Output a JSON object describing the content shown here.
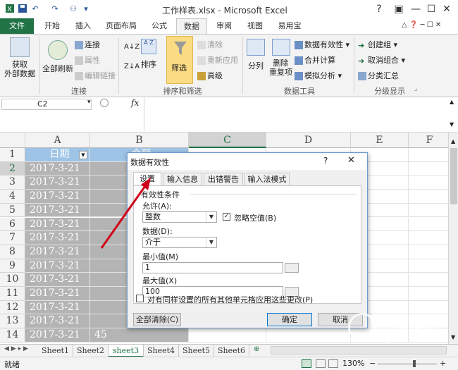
{
  "window": {
    "title": "工作样表.xlsx - Microsoft Excel",
    "help_icon": "?",
    "controls": [
      "restore-ribbon-icon",
      "minimize-icon",
      "maximize-icon",
      "close-icon"
    ]
  },
  "ribbon_tabs": [
    "文件",
    "开始",
    "插入",
    "页面布局",
    "公式",
    "数据",
    "审阅",
    "视图",
    "易用宝"
  ],
  "active_tab": "数据",
  "ribbon": {
    "get_external": "获取\n外部数据",
    "refresh_all": "全部刷新",
    "connections": "连接",
    "properties": "属性",
    "edit_links": "编辑链接",
    "connections_group": "连接",
    "sort_asc": "A↓Z",
    "sort": "排序",
    "filter": "筛选",
    "clear": "清除",
    "reapply": "重新应用",
    "advanced": "高级",
    "sort_filter_group": "排序和筛选",
    "text_to_columns": "分列",
    "remove_duplicates": "删除\n重复项",
    "data_validation": "数据有效性",
    "consolidate": "合并计算",
    "what_if": "模拟分析",
    "data_tools_group": "数据工具",
    "group": "创建组",
    "ungroup": "取消组合",
    "subtotal": "分类汇总",
    "outline_group": "分级显示"
  },
  "formula_bar": {
    "name_box": "C2",
    "fx": "fx"
  },
  "columns": [
    "A",
    "B",
    "C",
    "D",
    "E",
    "F"
  ],
  "rows": [
    {
      "n": "1",
      "a": "日期",
      "b": "金额"
    },
    {
      "n": "2",
      "a": "2017-3-21",
      "b": ""
    },
    {
      "n": "3",
      "a": "2017-3-21",
      "b": ""
    },
    {
      "n": "4",
      "a": "2017-3-21",
      "b": ""
    },
    {
      "n": "5",
      "a": "2017-3-21",
      "b": ""
    },
    {
      "n": "6",
      "a": "2017-3-21",
      "b": ""
    },
    {
      "n": "7",
      "a": "2017-3-21",
      "b": ""
    },
    {
      "n": "8",
      "a": "2017-3-21",
      "b": ""
    },
    {
      "n": "9",
      "a": "2017-3-21",
      "b": ""
    },
    {
      "n": "10",
      "a": "2017-3-21",
      "b": ""
    },
    {
      "n": "11",
      "a": "2017-3-21",
      "b": ""
    },
    {
      "n": "12",
      "a": "2017-3-21",
      "b": ""
    },
    {
      "n": "13",
      "a": "2017-3-21",
      "b": ""
    },
    {
      "n": "14",
      "a": "2017-3-21",
      "b": "45"
    }
  ],
  "sheets": [
    "Sheet1",
    "Sheet2",
    "sheet3",
    "Sheet4",
    "Sheet5",
    "Sheet6"
  ],
  "active_sheet": "sheet3",
  "status": {
    "ready": "就绪",
    "zoom": "130%"
  },
  "dialog": {
    "title": "数据有效性",
    "help": "?",
    "tabs": [
      "设置",
      "输入信息",
      "出错警告",
      "输入法模式"
    ],
    "section": "有效性条件",
    "allow_label": "允许(A):",
    "allow_value": "整数",
    "ignore_blank": "忽略空值(B)",
    "data_label": "数据(D):",
    "data_value": "介于",
    "min_label": "最小值(M)",
    "min_value": "1",
    "max_label": "最大值(X)",
    "max_value": "100",
    "apply_all": "对有同样设置的所有其他单元格应用这些更改(P)",
    "clear_all": "全部清除(C)",
    "ok": "确定",
    "cancel": "取消"
  },
  "watermark": {
    "brand": "搜狗指南",
    "url": "zhinan.sogou.com"
  },
  "colors": {
    "excel_green": "#217346",
    "selection": "#b4b4b4",
    "header_fill": "#9dc3e6",
    "arrow": "#d0021b"
  }
}
